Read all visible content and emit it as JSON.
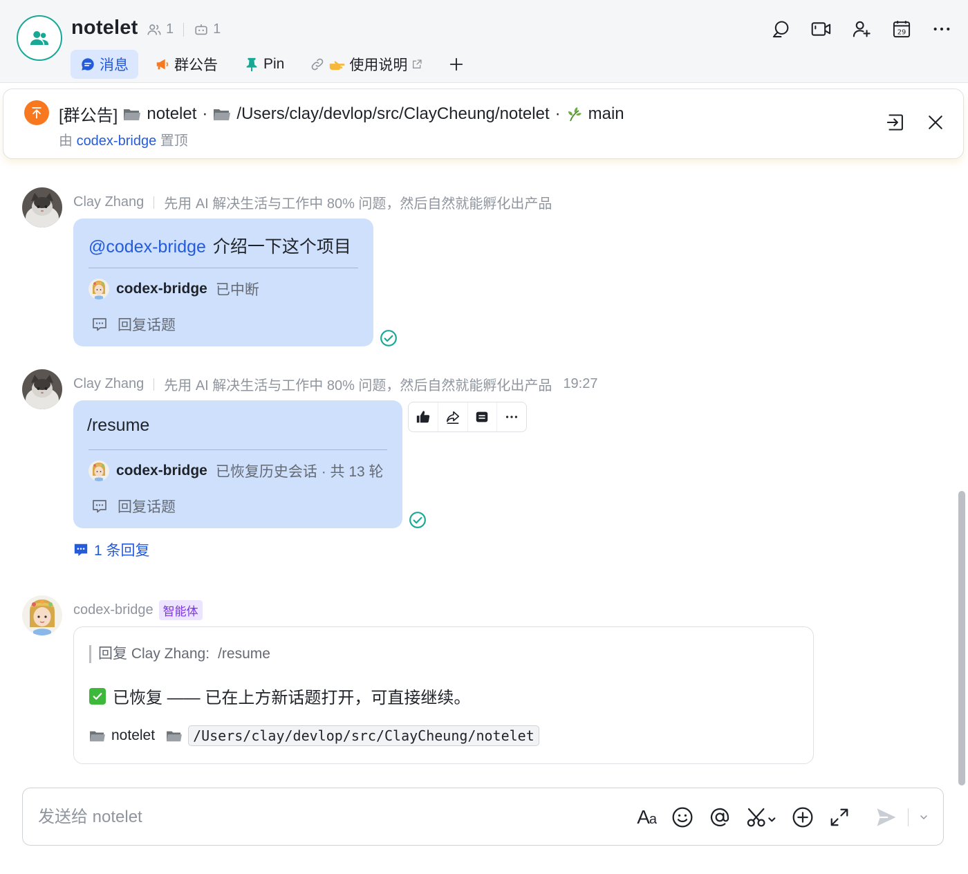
{
  "group": {
    "name": "notelet",
    "member_count": "1",
    "bot_count": "1"
  },
  "tabs": [
    {
      "label": "消息",
      "active": true
    },
    {
      "label": "群公告"
    },
    {
      "label": "Pin"
    },
    {
      "label": "使用说明"
    }
  ],
  "pinned": {
    "prefix": "[群公告]",
    "project": "notelet",
    "sep1": "·",
    "path": "/Users/clay/devlop/src/ClayCheung/notelet",
    "sep2": "·",
    "branch": "main",
    "by_prefix": "由",
    "by_user": "codex-bridge",
    "by_suffix": "置顶"
  },
  "messages": [
    {
      "sender": "Clay Zhang",
      "signature": "先用 AI 解决生活与工作中 80% 问题，然后自然就能孵化出产品",
      "mention": "@codex-bridge",
      "text": "介绍一下这个项目",
      "bot_name": "codex-bridge",
      "status": "已中断",
      "reply_label": "回复话题"
    },
    {
      "sender": "Clay Zhang",
      "signature": "先用 AI 解决生活与工作中 80% 问题，然后自然就能孵化出产品",
      "time": "19:27",
      "text": "/resume",
      "bot_name": "codex-bridge",
      "status": "已恢复历史会话 · 共 13 轮",
      "reply_label": "回复话题",
      "thread_replies": "1 条回复"
    },
    {
      "sender": "codex-bridge",
      "tag": "智能体",
      "quote_prefix": "回复 Clay Zhang:",
      "quote_text": "/resume",
      "done_text": "已恢复 —— 已在上方新话题打开，可直接继续。",
      "project": "notelet",
      "path": "/Users/clay/devlop/src/ClayCheung/notelet"
    }
  ],
  "composer": {
    "placeholder": "发送给 notelet",
    "aa_big": "A",
    "aa_small": "a"
  },
  "icons": {
    "header": [
      "search-icon",
      "video-icon",
      "add-member-icon",
      "calendar-icon",
      "more-icon"
    ],
    "toolbar": [
      "thumbs-up-icon",
      "share-icon",
      "quote-icon",
      "more-icon"
    ],
    "composer": [
      "text-format-icon",
      "emoji-icon",
      "mention-icon",
      "screenshot-icon",
      "add-icon",
      "expand-icon",
      "send-icon"
    ]
  },
  "calendar_day": "29",
  "colors": {
    "accent": "#245bdb",
    "bubble": "#cfe0fc",
    "group_teal": "#17a896",
    "pin_orange": "#f8781f",
    "read_green": "#17a896",
    "agent_tag": "#7a36e0"
  }
}
